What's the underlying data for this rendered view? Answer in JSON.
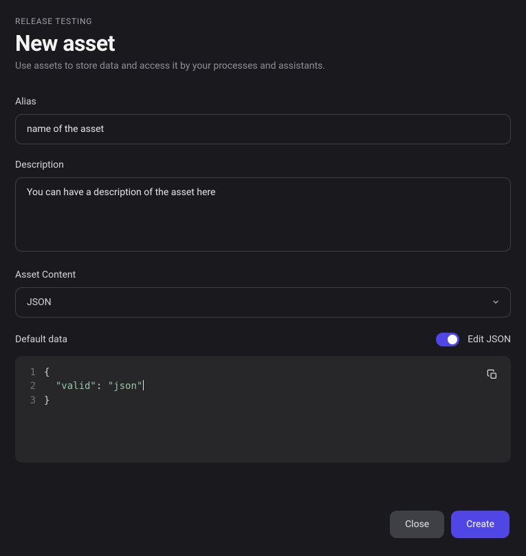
{
  "header": {
    "breadcrumb": "RELEASE TESTING",
    "title": "New asset",
    "subtitle": "Use assets to store data and access it by your processes and assistants."
  },
  "form": {
    "alias": {
      "label": "Alias",
      "value": "name of the asset"
    },
    "description": {
      "label": "Description",
      "value": "You can have a description of the asset here"
    },
    "asset_content": {
      "label": "Asset Content",
      "selected": "JSON"
    },
    "default_data": {
      "label": "Default data",
      "toggle_label": "Edit JSON",
      "toggle_on": true,
      "code": {
        "lines": [
          "1",
          "2",
          "3"
        ],
        "l1": "{",
        "l2_indent": "  ",
        "l2_key": "\"valid\"",
        "l2_colon": ": ",
        "l2_val": "\"json\"",
        "l3": "}"
      }
    }
  },
  "footer": {
    "close": "Close",
    "create": "Create"
  }
}
